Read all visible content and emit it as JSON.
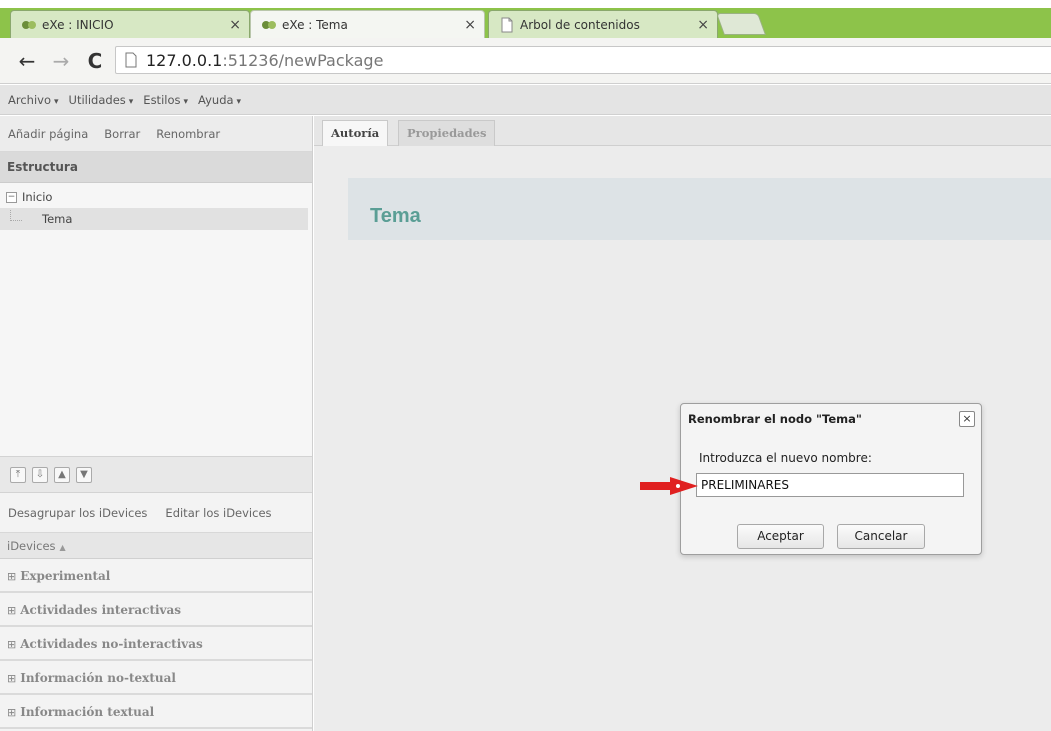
{
  "browser": {
    "tabs": [
      {
        "title": "eXe : INICIO",
        "active": false
      },
      {
        "title": "eXe : Tema",
        "active": true
      },
      {
        "title": "Arbol de contenidos",
        "active": false
      }
    ],
    "url_host": "127.0.0.1",
    "url_path": ":51236/newPackage",
    "close_glyph": "×"
  },
  "menubar": {
    "items": [
      {
        "label": "Archivo"
      },
      {
        "label": "Utilidades"
      },
      {
        "label": "Estilos"
      },
      {
        "label": "Ayuda"
      }
    ]
  },
  "sidebar": {
    "actions": [
      "Añadir página",
      "Borrar",
      "Renombrar"
    ],
    "structure_title": "Estructura",
    "tree": [
      {
        "label": "Inicio",
        "toggle": "−"
      },
      {
        "label": "Tema",
        "selected": true
      }
    ],
    "idevice_actions": [
      "Desagrupar los iDevices",
      "Editar los iDevices"
    ],
    "idevices_header": "iDevices",
    "categories": [
      "Experimental",
      "Actividades interactivas",
      "Actividades no-interactivas",
      "Información no-textual",
      "Información textual"
    ]
  },
  "main": {
    "tabs": [
      "Autoría",
      "Propiedades"
    ],
    "page_title": "Tema"
  },
  "dialog": {
    "title": "Renombrar el nodo \"Tema\"",
    "label": "Introduzca el nuevo nombre:",
    "input_value": "PRELIMINARES",
    "accept_label": "Aceptar",
    "cancel_label": "Cancelar"
  },
  "colors": {
    "tabstrip": "#8dc34a",
    "page_title": "#5a9e95",
    "annotation_arrow": "#e02020"
  }
}
